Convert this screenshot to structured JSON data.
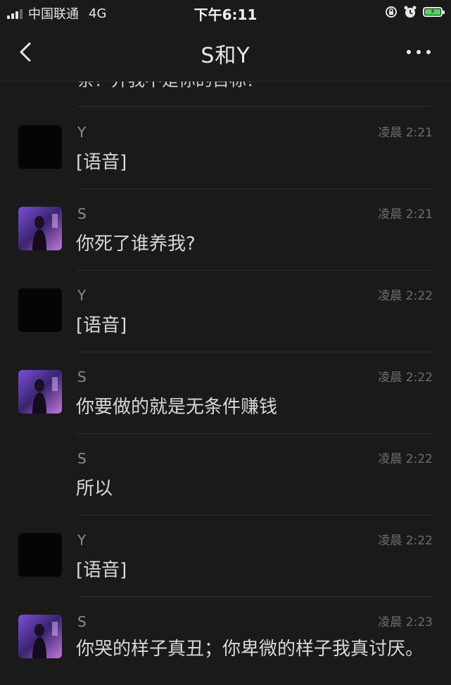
{
  "status_bar": {
    "carrier": "中国联通",
    "network": "4G",
    "time": "下午6:11",
    "icons": [
      "signal-icon",
      "orientation-lock-icon",
      "alarm-icon",
      "battery-charging-icon"
    ],
    "battery_color": "#4cd964"
  },
  "header": {
    "title": "S和Y",
    "back_icon": "chevron-left-icon",
    "more_icon": "more-horizontal-icon"
  },
  "clipped_top_text": "亲？并我不是你的目标？",
  "messages": [
    {
      "sender": "Y",
      "time": "凌晨 2:21",
      "content": "[语音]",
      "avatar": "dark"
    },
    {
      "sender": "S",
      "time": "凌晨 2:21",
      "content": "你死了谁养我?",
      "avatar": "photo"
    },
    {
      "sender": "Y",
      "time": "凌晨 2:22",
      "content": "[语音]",
      "avatar": "dark"
    },
    {
      "sender": "S",
      "time": "凌晨 2:22",
      "content": "你要做的就是无条件赚钱",
      "avatar": "photo"
    },
    {
      "sender": "S",
      "time": "凌晨 2:22",
      "content": "所以",
      "avatar": "none"
    },
    {
      "sender": "Y",
      "time": "凌晨 2:22",
      "content": "[语音]",
      "avatar": "dark"
    },
    {
      "sender": "S",
      "time": "凌晨 2:23",
      "content": "你哭的样子真丑；你卑微的样子我真讨厌。",
      "avatar": "photo"
    }
  ],
  "colors": {
    "background": "#1a1a1a",
    "divider": "#2e2e2e",
    "text_primary": "#d8d8d8",
    "text_secondary": "#8c8c8c"
  }
}
